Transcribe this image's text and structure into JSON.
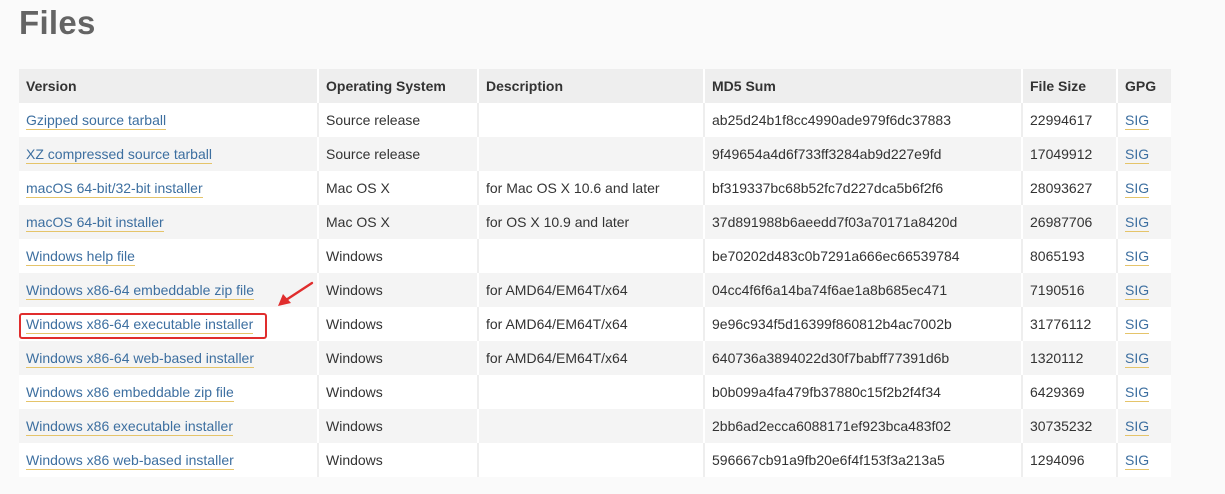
{
  "section": {
    "title": "Files"
  },
  "table": {
    "headers": [
      "Version",
      "Operating System",
      "Description",
      "MD5 Sum",
      "File Size",
      "GPG"
    ],
    "rows": [
      {
        "version": "Gzipped source tarball",
        "os": "Source release",
        "description": "",
        "md5": "ab25d24b1f8cc4990ade979f6dc37883",
        "size": "22994617",
        "gpg": "SIG"
      },
      {
        "version": "XZ compressed source tarball",
        "os": "Source release",
        "description": "",
        "md5": "9f49654a4d6f733ff3284ab9d227e9fd",
        "size": "17049912",
        "gpg": "SIG"
      },
      {
        "version": "macOS 64-bit/32-bit installer",
        "os": "Mac OS X",
        "description": "for Mac OS X 10.6 and later",
        "md5": "bf319337bc68b52fc7d227dca5b6f2f6",
        "size": "28093627",
        "gpg": "SIG"
      },
      {
        "version": "macOS 64-bit installer",
        "os": "Mac OS X",
        "description": "for OS X 10.9 and later",
        "md5": "37d891988b6aeedd7f03a70171a8420d",
        "size": "26987706",
        "gpg": "SIG"
      },
      {
        "version": "Windows help file",
        "os": "Windows",
        "description": "",
        "md5": "be70202d483c0b7291a666ec66539784",
        "size": "8065193",
        "gpg": "SIG"
      },
      {
        "version": "Windows x86-64 embeddable zip file",
        "os": "Windows",
        "description": "for AMD64/EM64T/x64",
        "md5": "04cc4f6f6a14ba74f6ae1a8b685ec471",
        "size": "7190516",
        "gpg": "SIG"
      },
      {
        "version": "Windows x86-64 executable installer",
        "os": "Windows",
        "description": "for AMD64/EM64T/x64",
        "md5": "9e96c934f5d16399f860812b4ac7002b",
        "size": "31776112",
        "gpg": "SIG",
        "highlighted": true
      },
      {
        "version": "Windows x86-64 web-based installer",
        "os": "Windows",
        "description": "for AMD64/EM64T/x64",
        "md5": "640736a3894022d30f7babff77391d6b",
        "size": "1320112",
        "gpg": "SIG"
      },
      {
        "version": "Windows x86 embeddable zip file",
        "os": "Windows",
        "description": "",
        "md5": "b0b099a4fa479fb37880c15f2b2f4f34",
        "size": "6429369",
        "gpg": "SIG"
      },
      {
        "version": "Windows x86 executable installer",
        "os": "Windows",
        "description": "",
        "md5": "2bb6ad2ecca6088171ef923bca483f02",
        "size": "30735232",
        "gpg": "SIG"
      },
      {
        "version": "Windows x86 web-based installer",
        "os": "Windows",
        "description": "",
        "md5": "596667cb91a9fb20e6f4f153f3a213a5",
        "size": "1294096",
        "gpg": "SIG"
      }
    ]
  },
  "annotation": {
    "icon": "red-arrow-icon",
    "color": "#e02d2d"
  },
  "colors": {
    "link": "#3d6fa0",
    "link_underline": "#e5c46a",
    "header_bg": "#eeeeee",
    "title": "#646464"
  }
}
